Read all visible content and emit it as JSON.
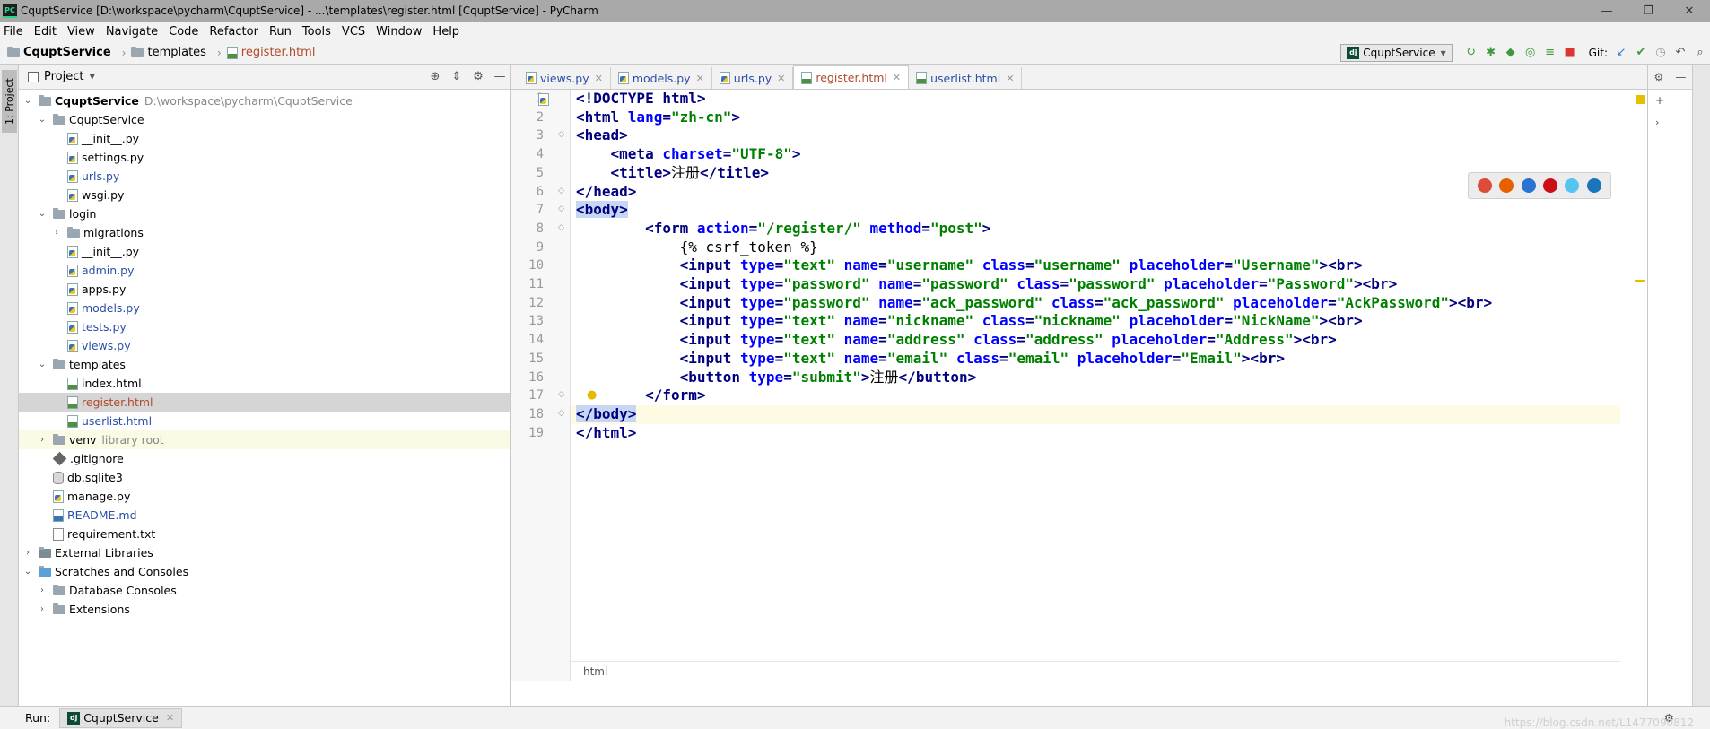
{
  "window": {
    "title": "CquptService [D:\\workspace\\pycharm\\CquptService] - ...\\templates\\register.html [CquptService] - PyCharm",
    "controls": [
      "—",
      "❐",
      "✕"
    ]
  },
  "menu": [
    "File",
    "Edit",
    "View",
    "Navigate",
    "Code",
    "Refactor",
    "Run",
    "Tools",
    "VCS",
    "Window",
    "Help"
  ],
  "breadcrumb": [
    "CquptService",
    "templates",
    "register.html"
  ],
  "run_config": "CquptService",
  "git_label": "Git:",
  "project_panel": {
    "title": "Project",
    "side_tab": "1: Project",
    "tree": [
      {
        "label": "CquptService",
        "path": "D:\\workspace\\pycharm\\CquptService",
        "depth": 0,
        "type": "folder",
        "open": true
      },
      {
        "label": "CquptService",
        "depth": 1,
        "type": "folder",
        "open": true
      },
      {
        "label": "__init__.py",
        "depth": 2,
        "type": "py"
      },
      {
        "label": "settings.py",
        "depth": 2,
        "type": "py"
      },
      {
        "label": "urls.py",
        "depth": 2,
        "type": "py",
        "color": "blue"
      },
      {
        "label": "wsgi.py",
        "depth": 2,
        "type": "py"
      },
      {
        "label": "login",
        "depth": 1,
        "type": "folder",
        "open": true
      },
      {
        "label": "migrations",
        "depth": 2,
        "type": "folder",
        "open": false
      },
      {
        "label": "__init__.py",
        "depth": 2,
        "type": "py"
      },
      {
        "label": "admin.py",
        "depth": 2,
        "type": "py",
        "color": "blue"
      },
      {
        "label": "apps.py",
        "depth": 2,
        "type": "py"
      },
      {
        "label": "models.py",
        "depth": 2,
        "type": "py",
        "color": "blue"
      },
      {
        "label": "tests.py",
        "depth": 2,
        "type": "py",
        "color": "blue"
      },
      {
        "label": "views.py",
        "depth": 2,
        "type": "py",
        "color": "blue"
      },
      {
        "label": "templates",
        "depth": 1,
        "type": "folder",
        "open": true
      },
      {
        "label": "index.html",
        "depth": 2,
        "type": "html"
      },
      {
        "label": "register.html",
        "depth": 2,
        "type": "html",
        "color": "red",
        "selected": true
      },
      {
        "label": "userlist.html",
        "depth": 2,
        "type": "html",
        "color": "blue"
      },
      {
        "label": "venv",
        "path": "library root",
        "depth": 1,
        "type": "folder",
        "open": false,
        "venv": true
      },
      {
        "label": ".gitignore",
        "depth": 1,
        "type": "git"
      },
      {
        "label": "db.sqlite3",
        "depth": 1,
        "type": "db"
      },
      {
        "label": "manage.py",
        "depth": 1,
        "type": "py"
      },
      {
        "label": "README.md",
        "depth": 1,
        "type": "md",
        "color": "blue"
      },
      {
        "label": "requirement.txt",
        "depth": 1,
        "type": "file"
      },
      {
        "label": "External Libraries",
        "depth": 0,
        "type": "lib",
        "open": false
      },
      {
        "label": "Scratches and Consoles",
        "depth": 0,
        "type": "scratch",
        "open": true
      },
      {
        "label": "Database Consoles",
        "depth": 1,
        "type": "folder",
        "open": false
      },
      {
        "label": "Extensions",
        "depth": 1,
        "type": "folder",
        "open": false
      }
    ]
  },
  "editor": {
    "tabs": [
      {
        "label": "views.py",
        "type": "py"
      },
      {
        "label": "models.py",
        "type": "py"
      },
      {
        "label": "urls.py",
        "type": "py"
      },
      {
        "label": "register.html",
        "type": "html",
        "active": true
      },
      {
        "label": "userlist.html",
        "type": "html"
      }
    ],
    "lines": [
      [
        [
          "tag",
          "<!DOCTYPE "
        ],
        [
          "tag",
          "html"
        ],
        [
          "tag",
          ">"
        ]
      ],
      [
        [
          "tag",
          "<html "
        ],
        [
          "attr",
          "lang"
        ],
        [
          "tag",
          "="
        ],
        [
          "str",
          "\"zh-cn\""
        ],
        [
          "tag",
          ">"
        ]
      ],
      [
        [
          "tag",
          "<head>"
        ]
      ],
      [
        [
          "txt",
          "    "
        ],
        [
          "tag",
          "<meta "
        ],
        [
          "attr",
          "charset"
        ],
        [
          "tag",
          "="
        ],
        [
          "str",
          "\"UTF-8\""
        ],
        [
          "tag",
          ">"
        ]
      ],
      [
        [
          "txt",
          "    "
        ],
        [
          "tag",
          "<title>"
        ],
        [
          "txt",
          "注册"
        ],
        [
          "tag",
          "</title>"
        ]
      ],
      [
        [
          "tag",
          "</head>"
        ]
      ],
      [
        [
          "sel",
          "<body>"
        ]
      ],
      [
        [
          "txt",
          "        "
        ],
        [
          "tag",
          "<form "
        ],
        [
          "attr",
          "action"
        ],
        [
          "tag",
          "="
        ],
        [
          "str",
          "\"/register/\" "
        ],
        [
          "attr",
          "method"
        ],
        [
          "tag",
          "="
        ],
        [
          "str",
          "\"post\""
        ],
        [
          "tag",
          ">"
        ]
      ],
      [
        [
          "txt",
          "            {% csrf_token %}"
        ]
      ],
      [
        [
          "txt",
          "            "
        ],
        [
          "tag",
          "<input "
        ],
        [
          "attr",
          "type"
        ],
        [
          "tag",
          "="
        ],
        [
          "str",
          "\"text\" "
        ],
        [
          "attr",
          "name"
        ],
        [
          "tag",
          "="
        ],
        [
          "str",
          "\"username\" "
        ],
        [
          "attr",
          "class"
        ],
        [
          "tag",
          "="
        ],
        [
          "str",
          "\"username\" "
        ],
        [
          "attr",
          "placeholder"
        ],
        [
          "tag",
          "="
        ],
        [
          "str",
          "\"Username\""
        ],
        [
          "tag",
          "><br>"
        ]
      ],
      [
        [
          "txt",
          "            "
        ],
        [
          "tag",
          "<input "
        ],
        [
          "attr",
          "type"
        ],
        [
          "tag",
          "="
        ],
        [
          "str",
          "\"password\" "
        ],
        [
          "attr",
          "name"
        ],
        [
          "tag",
          "="
        ],
        [
          "str",
          "\"password\" "
        ],
        [
          "attr",
          "class"
        ],
        [
          "tag",
          "="
        ],
        [
          "str",
          "\"password\" "
        ],
        [
          "attr",
          "placeholder"
        ],
        [
          "tag",
          "="
        ],
        [
          "str",
          "\"Password\""
        ],
        [
          "tag",
          "><br>"
        ]
      ],
      [
        [
          "txt",
          "            "
        ],
        [
          "tag",
          "<input "
        ],
        [
          "attr",
          "type"
        ],
        [
          "tag",
          "="
        ],
        [
          "str",
          "\"password\" "
        ],
        [
          "attr",
          "name"
        ],
        [
          "tag",
          "="
        ],
        [
          "str",
          "\"ack_password\" "
        ],
        [
          "attr",
          "class"
        ],
        [
          "tag",
          "="
        ],
        [
          "str",
          "\"ack_password\" "
        ],
        [
          "attr",
          "placeholder"
        ],
        [
          "tag",
          "="
        ],
        [
          "str",
          "\"AckPassword\""
        ],
        [
          "tag",
          "><br>"
        ]
      ],
      [
        [
          "txt",
          "            "
        ],
        [
          "tag",
          "<input "
        ],
        [
          "attr",
          "type"
        ],
        [
          "tag",
          "="
        ],
        [
          "str",
          "\"text\" "
        ],
        [
          "attr",
          "name"
        ],
        [
          "tag",
          "="
        ],
        [
          "str",
          "\"nickname\" "
        ],
        [
          "attr",
          "class"
        ],
        [
          "tag",
          "="
        ],
        [
          "str",
          "\"nickname\" "
        ],
        [
          "attr",
          "placeholder"
        ],
        [
          "tag",
          "="
        ],
        [
          "str",
          "\"NickName\""
        ],
        [
          "tag",
          "><br>"
        ]
      ],
      [
        [
          "txt",
          "            "
        ],
        [
          "tag",
          "<input "
        ],
        [
          "attr",
          "type"
        ],
        [
          "tag",
          "="
        ],
        [
          "str",
          "\"text\" "
        ],
        [
          "attr",
          "name"
        ],
        [
          "tag",
          "="
        ],
        [
          "str",
          "\"address\" "
        ],
        [
          "attr",
          "class"
        ],
        [
          "tag",
          "="
        ],
        [
          "str",
          "\"address\" "
        ],
        [
          "attr",
          "placeholder"
        ],
        [
          "tag",
          "="
        ],
        [
          "str",
          "\"Address\""
        ],
        [
          "tag",
          "><br>"
        ]
      ],
      [
        [
          "txt",
          "            "
        ],
        [
          "tag",
          "<input "
        ],
        [
          "attr",
          "type"
        ],
        [
          "tag",
          "="
        ],
        [
          "str",
          "\"text\" "
        ],
        [
          "attr",
          "name"
        ],
        [
          "tag",
          "="
        ],
        [
          "str",
          "\"email\" "
        ],
        [
          "attr",
          "class"
        ],
        [
          "tag",
          "="
        ],
        [
          "str",
          "\"email\" "
        ],
        [
          "attr",
          "placeholder"
        ],
        [
          "tag",
          "="
        ],
        [
          "str",
          "\"Email\""
        ],
        [
          "tag",
          "><br>"
        ]
      ],
      [
        [
          "txt",
          "            "
        ],
        [
          "tag",
          "<button "
        ],
        [
          "attr",
          "type"
        ],
        [
          "tag",
          "="
        ],
        [
          "str",
          "\"submit\""
        ],
        [
          "tag",
          ">"
        ],
        [
          "txt",
          "注册"
        ],
        [
          "tag",
          "</button>"
        ]
      ],
      [
        [
          "txt",
          "        "
        ],
        [
          "tag",
          "</form>"
        ]
      ],
      [
        [
          "sel",
          "</body>"
        ]
      ],
      [
        [
          "tag",
          "</html>"
        ]
      ]
    ],
    "status_path": "html"
  },
  "browser_colors": [
    "#dd4b39",
    "#e66000",
    "#2b73d2",
    "#cc0f16",
    "#56c3f0",
    "#1b75bb"
  ],
  "run_bar": {
    "label": "Run:",
    "tab": "CquptService"
  },
  "watermark": "https://blog.csdn.net/L1477090812"
}
